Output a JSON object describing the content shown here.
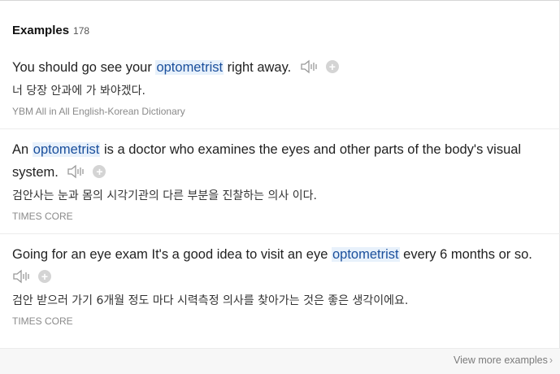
{
  "header": {
    "title": "Examples",
    "count": "178"
  },
  "examples": [
    {
      "before": "You should go see your ",
      "keyword": "optometrist",
      "after": " right away.",
      "translation": "너 당장 안과에 가 봐야겠다.",
      "source": "YBM All in All English-Korean Dictionary"
    },
    {
      "before": "An ",
      "keyword": "optometrist",
      "after": " is a doctor who examines the eyes and other parts of the body's visual system.",
      "translation": "검안사는 눈과 몸의 시각기관의 다른 부분을 진찰하는 의사 이다.",
      "source": "TIMES CORE"
    },
    {
      "before": "Going for an eye exam It's a good idea to visit an eye ",
      "keyword": "optometrist",
      "after": " every 6 months or so.",
      "translation": "검안 받으러 가기 6개월 정도 마다 시력측정 의사를 찾아가는 것은 좋은 생각이에요.",
      "source": "TIMES CORE"
    }
  ],
  "footer": {
    "view_more": "View more examples",
    "chevron": "›"
  },
  "icons": {
    "audio": "speaker-icon",
    "add": "add-icon"
  },
  "colors": {
    "keyword_bg": "#e8f1fb",
    "keyword_text": "#1a4f9c",
    "source": "#8a8a8a"
  }
}
